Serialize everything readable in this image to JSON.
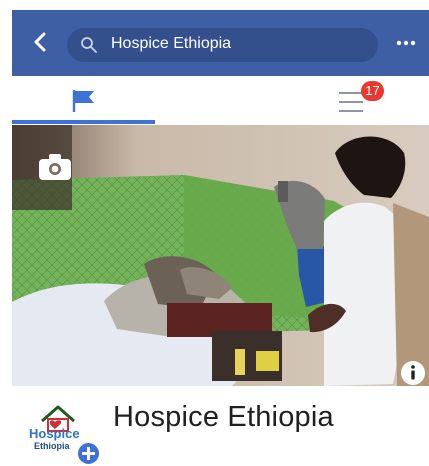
{
  "header": {
    "search_text": "Hospice Ethiopia"
  },
  "tabs": {
    "menu_badge": "17"
  },
  "profile": {
    "page_name": "Hospice Ethiopia",
    "logo_text_line1": "Hospice",
    "logo_text_line2": "Ethiopia"
  },
  "icons": {
    "back": "back-arrow-icon",
    "search": "search-icon",
    "more": "more-dots-icon",
    "flag": "flag-icon",
    "menu": "menu-icon",
    "camera": "camera-icon",
    "info": "info-icon",
    "plus": "plus-icon"
  },
  "colors": {
    "header": "#3e5fa3",
    "search_bar": "#33508d",
    "accent": "#3e72d8",
    "badge": "#e6392f"
  }
}
